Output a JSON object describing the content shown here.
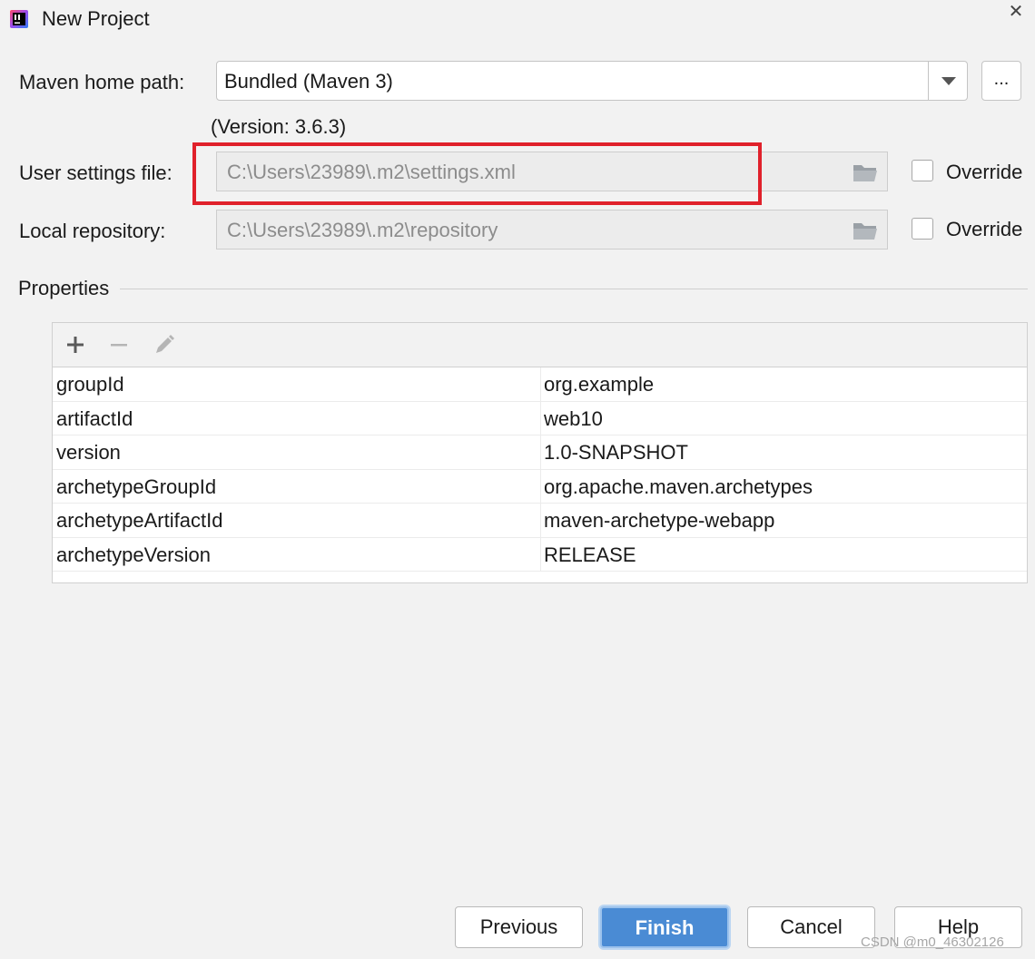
{
  "window": {
    "title": "New Project",
    "close_glyph": "✕",
    "app_icon": "intellij-idea-icon"
  },
  "maven": {
    "home_path_label": "Maven home path:",
    "home_path_value": "Bundled (Maven 3)",
    "browse_label": "...",
    "version_text": "(Version: 3.6.3)",
    "user_settings_label": "User settings file:",
    "user_settings_value": "C:\\Users\\23989\\.m2\\settings.xml",
    "user_settings_override_label": "Override",
    "user_settings_override_checked": false,
    "local_repo_label": "Local repository:",
    "local_repo_value": "C:\\Users\\23989\\.m2\\repository",
    "local_repo_override_label": "Override",
    "local_repo_override_checked": false
  },
  "properties": {
    "section_label": "Properties",
    "toolbar": {
      "add_icon": "plus-icon",
      "remove_icon": "minus-icon",
      "edit_icon": "pencil-icon"
    },
    "rows": [
      {
        "key": "groupId",
        "value": "org.example"
      },
      {
        "key": "artifactId",
        "value": "web10"
      },
      {
        "key": "version",
        "value": "1.0-SNAPSHOT"
      },
      {
        "key": "archetypeGroupId",
        "value": "org.apache.maven.archetypes"
      },
      {
        "key": "archetypeArtifactId",
        "value": "maven-archetype-webapp"
      },
      {
        "key": "archetypeVersion",
        "value": "RELEASE"
      }
    ]
  },
  "footer": {
    "previous_label": "Previous",
    "finish_label": "Finish",
    "cancel_label": "Cancel",
    "help_label": "Help"
  },
  "watermark": "CSDN @m0_46302126",
  "colors": {
    "highlight": "#e0212b",
    "primary_button": "#4a8bd4",
    "disabled_text": "#8c8c8c"
  }
}
